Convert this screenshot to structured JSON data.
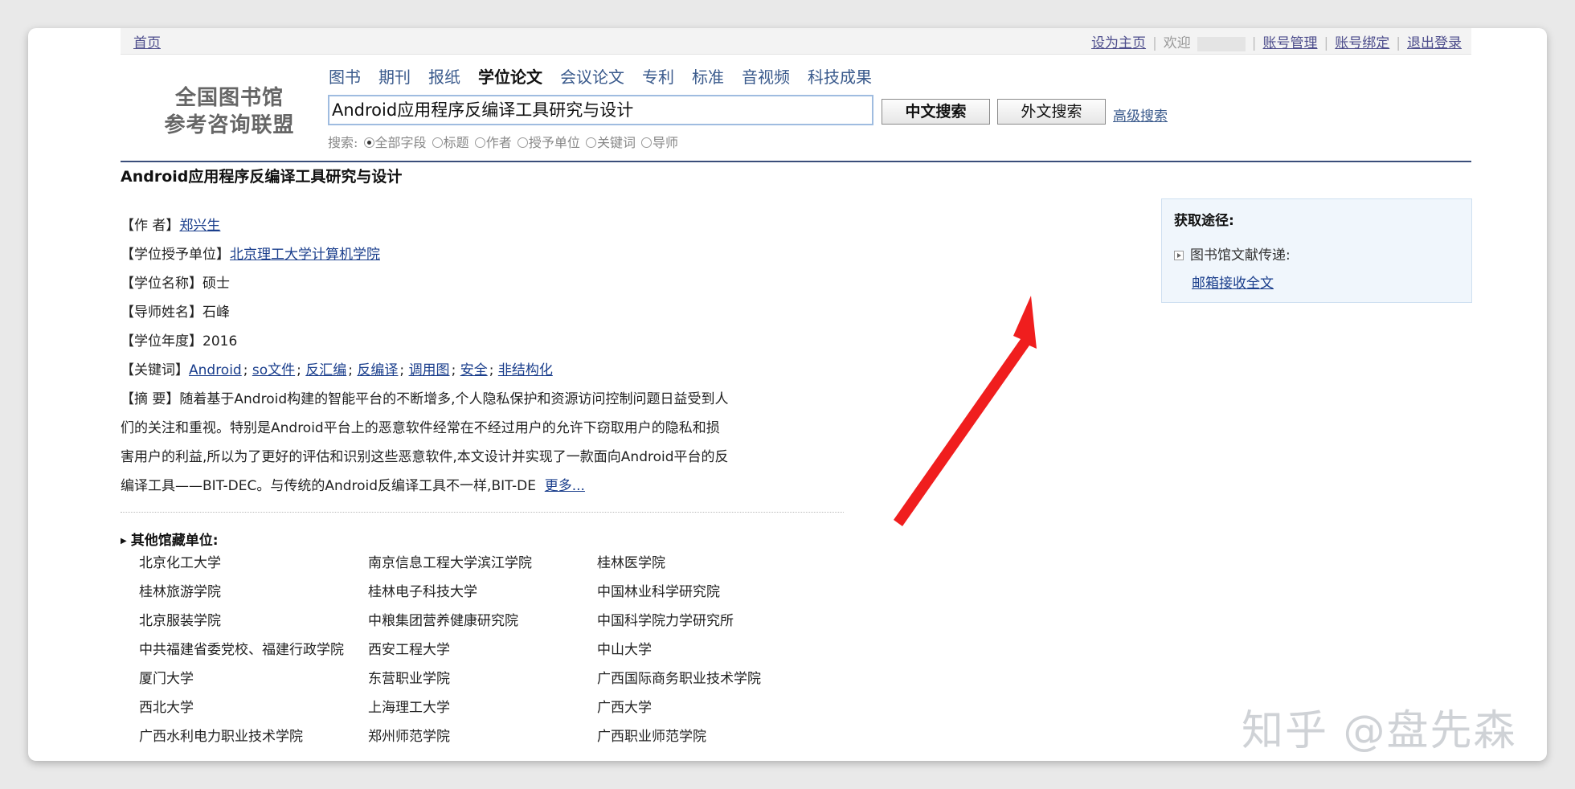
{
  "topbar": {
    "home": "首页",
    "set_home": "设为主页",
    "welcome": "欢迎",
    "account_manage": "账号管理",
    "account_bind": "账号绑定",
    "logout": "退出登录"
  },
  "logo": {
    "line1": "全国图书馆",
    "line2": "参考咨询联盟"
  },
  "nav": {
    "tabs": [
      "图书",
      "期刊",
      "报纸",
      "学位论文",
      "会议论文",
      "专利",
      "标准",
      "音视频",
      "科技成果"
    ],
    "active": "学位论文"
  },
  "search": {
    "value": "Android应用程序反编译工具研究与设计",
    "cn_button": "中文搜索",
    "foreign_button": "外文搜索",
    "advanced": "高级搜索",
    "scope_label": "搜索:",
    "options": [
      "全部字段",
      "标题",
      "作者",
      "授予单位",
      "关键词",
      "导师"
    ],
    "selected": "全部字段"
  },
  "record": {
    "title": "Android应用程序反编译工具研究与设计",
    "author_label": "【作 者】",
    "author": "郑兴生",
    "unit_label": "【学位授予单位】",
    "unit": "北京理工大学计算机学院",
    "degree_label": "【学位名称】",
    "degree": "硕士",
    "advisor_label": "【导师姓名】",
    "advisor": "石峰",
    "year_label": "【学位年度】",
    "year": "2016",
    "keywords_label": "【关键词】",
    "keywords": [
      "Android",
      "so文件",
      "反汇编",
      "反编译",
      "调用图",
      "安全",
      "非结构化"
    ],
    "abstract_label": "【摘 要】",
    "abstract": "随着基于Android构建的智能平台的不断增多,个人隐私保护和资源访问控制问题日益受到人们的关注和重视。特别是Android平台上的恶意软件经常在不经过用户的允许下窃取用户的隐私和损害用户的利益,所以为了更好的评估和识别这些恶意软件,本文设计并实现了一款面向Android平台的反编译工具——BIT-DEC。与传统的Android反编译工具不一样,BIT-DE",
    "more": "更多..."
  },
  "holdings": {
    "title": "其他馆藏单位:",
    "libraries": [
      "北京化工大学",
      "南京信息工程大学滨江学院",
      "桂林医学院",
      "桂林旅游学院",
      "桂林电子科技大学",
      "中国林业科学研究院",
      "北京服装学院",
      "中粮集团营养健康研究院",
      "中国科学院力学研究所",
      "中共福建省委党校、福建行政学院",
      "西安工程大学",
      "中山大学",
      "厦门大学",
      "东营职业学院",
      "广西国际商务职业技术学院",
      "西北大学",
      "上海理工大学",
      "广西大学",
      "广西水利电力职业技术学院",
      "郑州师范学院",
      "广西职业师范学院"
    ]
  },
  "access": {
    "title": "获取途径:",
    "delivery": "图书馆文献传递:",
    "email_link": "邮箱接收全文"
  },
  "watermark": "知乎 @盘先森",
  "colors": {
    "arrow": "#f01e1e",
    "header_rule": "#3a4e7a",
    "link": "#1a3e8c"
  }
}
